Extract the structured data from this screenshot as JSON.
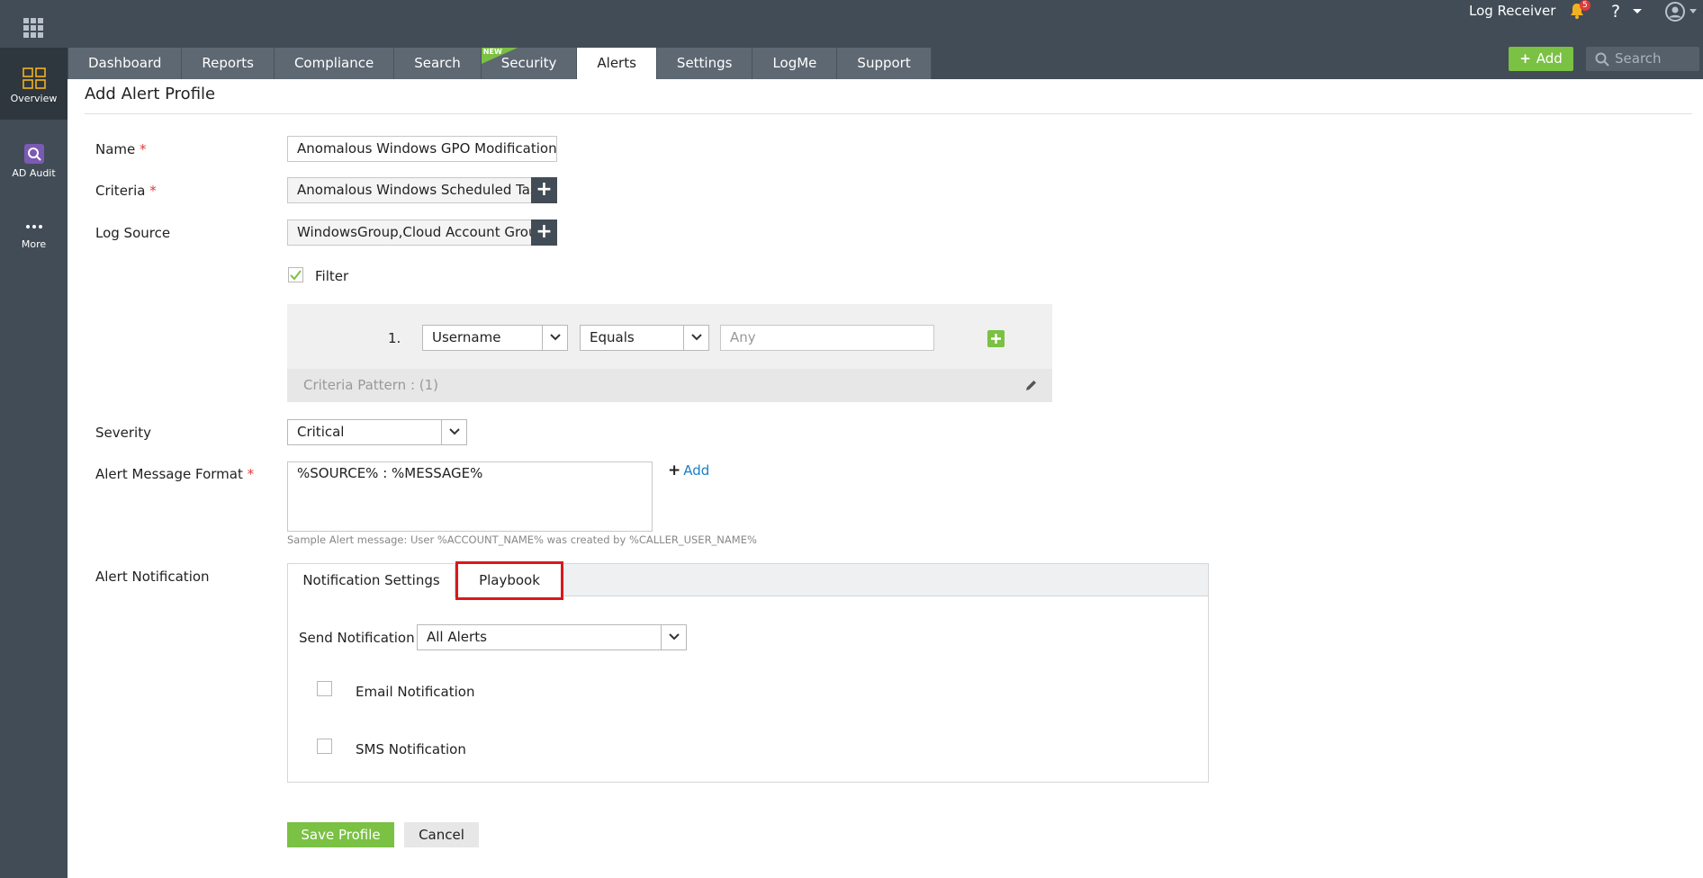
{
  "header": {
    "log_receiver": "Log Receiver",
    "notification_count": "5",
    "help": "?",
    "add_label": "Add",
    "search_placeholder": "Search"
  },
  "tabs": [
    {
      "label": "Dashboard"
    },
    {
      "label": "Reports"
    },
    {
      "label": "Compliance"
    },
    {
      "label": "Search"
    },
    {
      "label": "Security",
      "badge": "NEW"
    },
    {
      "label": "Alerts",
      "active": true
    },
    {
      "label": "Settings"
    },
    {
      "label": "LogMe"
    },
    {
      "label": "Support"
    }
  ],
  "leftrail": {
    "items": [
      {
        "label": "Overview",
        "icon": "overview-grid-icon",
        "active": true
      },
      {
        "label": "AD Audit",
        "icon": "ad-audit-icon"
      },
      {
        "label": "More",
        "icon": "more-dots-icon"
      }
    ]
  },
  "page": {
    "title": "Add Alert Profile"
  },
  "form": {
    "name_label": "Name",
    "name_value": "Anomalous Windows GPO Modification",
    "criteria_label": "Criteria",
    "criteria_value": "Anomalous Windows Scheduled Task",
    "log_source_label": "Log Source",
    "log_source_value": "WindowsGroup,Cloud Account Group",
    "required_mark": "*",
    "filter_label": "Filter",
    "filter_checked": true,
    "filter": {
      "row_number": "1.",
      "field": "Username",
      "operator": "Equals",
      "value_placeholder": "Any",
      "pattern": "Criteria Pattern : (1)"
    },
    "severity_label": "Severity",
    "severity_value": "Critical",
    "message_label": "Alert Message Format",
    "message_value": "%SOURCE% : %MESSAGE%",
    "message_add": "Add",
    "sample_message": "Sample Alert message: User %ACCOUNT_NAME% was created by %CALLER_USER_NAME%",
    "notification_label": "Alert Notification"
  },
  "notification": {
    "tabs": [
      {
        "label": "Notification Settings",
        "active": true
      },
      {
        "label": "Playbook",
        "highlighted": true
      }
    ],
    "send_label": "Send Notification",
    "send_value": "All Alerts",
    "email_label": "Email Notification",
    "sms_label": "SMS Notification"
  },
  "actions": {
    "save": "Save Profile",
    "cancel": "Cancel"
  },
  "colors": {
    "topbar": "#424c56",
    "accent_green": "#7bc143",
    "link_blue": "#1a7fc6",
    "required_red": "#e03a3a",
    "highlight_red": "#d9191c"
  }
}
